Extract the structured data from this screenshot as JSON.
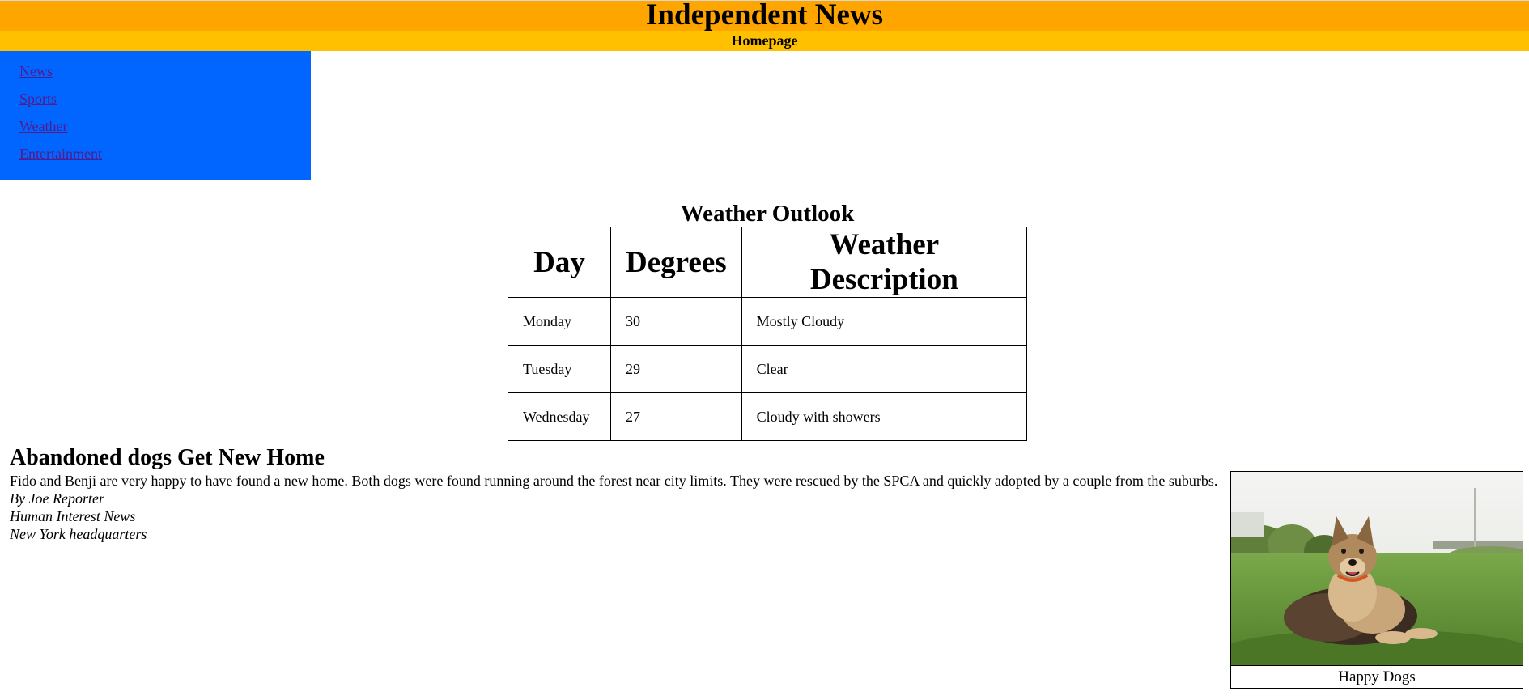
{
  "header": {
    "title": "Independent News",
    "subtitle": "Homepage"
  },
  "sidebar": {
    "items": [
      {
        "label": "News"
      },
      {
        "label": "Sports"
      },
      {
        "label": "Weather"
      },
      {
        "label": "Entertainment"
      }
    ]
  },
  "weather": {
    "title": "Weather Outlook",
    "columns": [
      "Day",
      "Degrees",
      "Weather Description"
    ],
    "rows": [
      {
        "day": "Monday",
        "degrees": "30",
        "description": "Mostly Cloudy"
      },
      {
        "day": "Tuesday",
        "degrees": "29",
        "description": "Clear"
      },
      {
        "day": "Wednesday",
        "degrees": "27",
        "description": "Cloudy with showers"
      }
    ]
  },
  "article": {
    "title": "Abandoned dogs Get New Home",
    "body": "Fido and Benji are very happy to have found a new home. Both dogs were found running around the forest near city limits. They were rescued by the SPCA and quickly adopted by a couple from the suburbs.",
    "byline": "By Joe Reporter",
    "section": "Human Interest News",
    "location": "New York headquarters"
  },
  "figure": {
    "caption": "Happy Dogs"
  },
  "colors": {
    "header": "#FFA500",
    "subheader": "#FFC000",
    "sidebar": "#0066FF",
    "link": "#551A8B"
  }
}
